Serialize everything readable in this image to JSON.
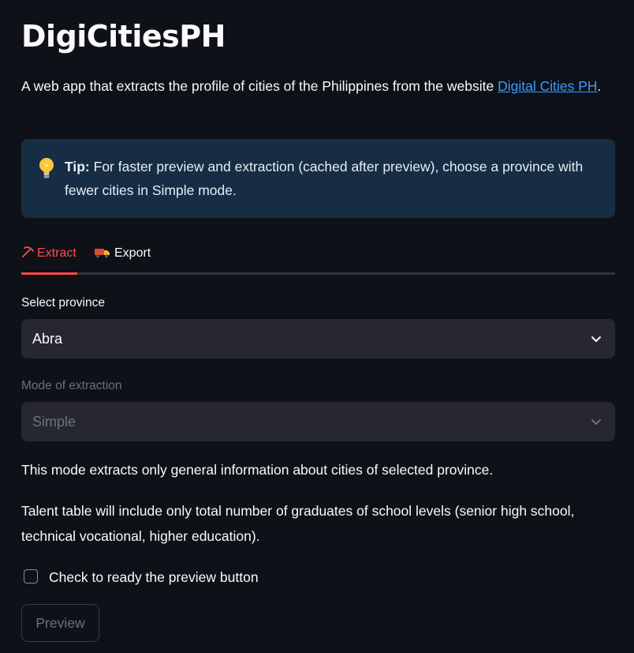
{
  "header": {
    "title": "DigiCitiesPH",
    "intro_text": "A web app that extracts the profile of cities of the Philippines from the website ",
    "link_text": "Digital Cities PH",
    "intro_suffix": "."
  },
  "tip": {
    "icon": "lightbulb-icon",
    "bold_label": "Tip:",
    "text": " For faster preview and extraction (cached after preview), choose a province with fewer cities in Simple mode."
  },
  "tabs": [
    {
      "icon": "pickaxe-icon",
      "label": "Extract",
      "active": true
    },
    {
      "icon": "truck-icon",
      "label": "Export",
      "active": false
    }
  ],
  "province_select": {
    "label": "Select province",
    "value": "Abra"
  },
  "mode_select": {
    "label": "Mode of extraction",
    "value": "Simple",
    "disabled": true
  },
  "descriptions": {
    "mode_info": "This mode extracts only general information about cities of selected province.",
    "talent_info": "Talent table will include only total number of graduates of school levels (senior high school, technical vocational, higher education)."
  },
  "checkbox": {
    "label": "Check to ready the preview button",
    "checked": false
  },
  "preview_button": {
    "label": "Preview",
    "disabled": true
  },
  "colors": {
    "background": "#0e1117",
    "accent": "#ff4b4b",
    "link": "#3b9cff",
    "tip_background": "#172d43",
    "input_background": "#262730"
  }
}
